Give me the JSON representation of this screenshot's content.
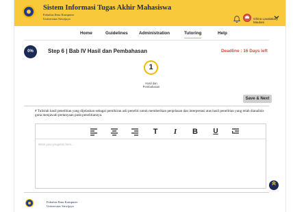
{
  "header": {
    "title": "Sistem Informasi Tugas Akhir Mahasiswa",
    "faculty": "Fakultas Ilmu Komputer",
    "university": "Universitas Sriwijaya",
    "user_name": "Ghina Laxalatiary Maulani"
  },
  "nav": {
    "items": [
      "Home",
      "Guidelines",
      "Administration",
      "Tutoring",
      "Help"
    ],
    "active": "Tutoring"
  },
  "step": {
    "progress": "0%",
    "title": "Step 6 | Bab IV Hasil dan Pembahasan",
    "deadline": "Deadline : 16 Days left",
    "number": "1",
    "number_label": "Hasil dan Pembahasan",
    "save_label": "Save & Next"
  },
  "editor": {
    "instruction": "# Tulislah hasil penelitian yang dijelaskan sebagai pemikiran asli peneliti untuk memberikan penjelasan dan interpretasi atas hasil penelitian yang telah dianalisis guna menjawab pertanyaan pada penelitiannya.",
    "placeholder": "Write your progress here...",
    "toolbar": [
      "align-left-icon",
      "align-center-icon",
      "align-right-icon",
      "text-icon",
      "italic-icon",
      "bold-icon",
      "underline-icon",
      "indent-icon"
    ],
    "toolbar_glyphs": {
      "text": "T",
      "italic": "I",
      "bold": "B",
      "underline": "U"
    }
  },
  "footer": {
    "faculty": "Fakultas Ilmu Komputer",
    "university": "Universitas Sriwijaya"
  },
  "colors": {
    "brand_yellow": "#f7c93b",
    "navy": "#1b2a55",
    "deadline_red": "#e0443a"
  }
}
